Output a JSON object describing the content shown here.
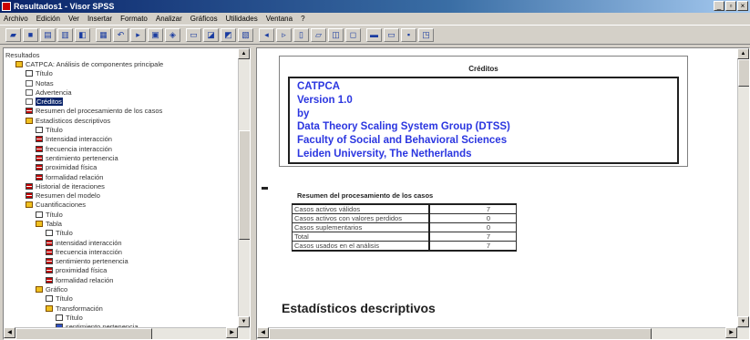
{
  "window": {
    "title": "Resultados1 - Visor SPSS",
    "controls": [
      "minimize",
      "restore",
      "close"
    ]
  },
  "menu": [
    "Archivo",
    "Edición",
    "Ver",
    "Insertar",
    "Formato",
    "Analizar",
    "Gráficos",
    "Utilidades",
    "Ventana",
    "?"
  ],
  "toolbar": {
    "buttons": [
      "open-icon",
      "save-icon",
      "print-icon",
      "print-preview-icon",
      "export-icon",
      "recall-dialog-icon",
      "undo-icon",
      "goto-case-icon",
      "variables-icon",
      "find-icon",
      "insert-cases-icon",
      "weight-cases-icon",
      "select-cases-icon",
      "value-labels-icon",
      "promote-icon",
      "demote-icon",
      "expand-icon",
      "collapse-icon",
      "show-icon",
      "hide-icon",
      "insert-heading-icon",
      "insert-title-icon",
      "insert-text-icon",
      "designate-window-icon"
    ]
  },
  "tree": [
    {
      "label": "Resultados",
      "depth": 0,
      "icon": "none"
    },
    {
      "label": "CATPCA: Análisis de componentes principale",
      "depth": 1,
      "icon": "book"
    },
    {
      "label": "Título",
      "depth": 2,
      "icon": "title"
    },
    {
      "label": "Notas",
      "depth": 2,
      "icon": "doc"
    },
    {
      "label": "Advertencia",
      "depth": 2,
      "icon": "doc"
    },
    {
      "label": "Créditos",
      "depth": 2,
      "icon": "doc",
      "selected": true
    },
    {
      "label": "Resumen del procesamiento de los casos",
      "depth": 2,
      "icon": "table"
    },
    {
      "label": "Estadísticos descriptivos",
      "depth": 2,
      "icon": "book"
    },
    {
      "label": "Título",
      "depth": 3,
      "icon": "title"
    },
    {
      "label": "Intensidad interacción",
      "depth": 3,
      "icon": "table"
    },
    {
      "label": "frecuencia interacción",
      "depth": 3,
      "icon": "table"
    },
    {
      "label": "sentimiento pertenencia",
      "depth": 3,
      "icon": "table"
    },
    {
      "label": "proximidad física",
      "depth": 3,
      "icon": "table"
    },
    {
      "label": "formalidad relación",
      "depth": 3,
      "icon": "table"
    },
    {
      "label": "Historial de iteraciones",
      "depth": 2,
      "icon": "table"
    },
    {
      "label": "Resumen del modelo",
      "depth": 2,
      "icon": "table"
    },
    {
      "label": "Cuantificaciones",
      "depth": 2,
      "icon": "book"
    },
    {
      "label": "Título",
      "depth": 3,
      "icon": "title"
    },
    {
      "label": "Tabla",
      "depth": 3,
      "icon": "book"
    },
    {
      "label": "Título",
      "depth": 4,
      "icon": "title"
    },
    {
      "label": "intensidad interacción",
      "depth": 4,
      "icon": "table"
    },
    {
      "label": "frecuencia interacción",
      "depth": 4,
      "icon": "table"
    },
    {
      "label": "sentimiento pertenencia",
      "depth": 4,
      "icon": "table"
    },
    {
      "label": "proximidad física",
      "depth": 4,
      "icon": "table"
    },
    {
      "label": "formalidad relación",
      "depth": 4,
      "icon": "table"
    },
    {
      "label": "Gráfico",
      "depth": 3,
      "icon": "book"
    },
    {
      "label": "Título",
      "depth": 4,
      "icon": "title"
    },
    {
      "label": "Transformación",
      "depth": 4,
      "icon": "book"
    },
    {
      "label": "Título",
      "depth": 5,
      "icon": "title"
    },
    {
      "label": "sentimiento pertenencia",
      "depth": 5,
      "icon": "chart"
    }
  ],
  "credits": {
    "title": "Créditos",
    "lines": [
      "CATPCA",
      "Version 1.0",
      "by",
      "Data Theory Scaling System Group (DTSS)",
      "Faculty of Social and Behavioral Sciences",
      "Leiden University, The Netherlands"
    ]
  },
  "case_summary": {
    "title": "Resumen del procesamiento de los casos",
    "rows": [
      {
        "label": "Casos activos válidos",
        "value": "7"
      },
      {
        "label": "Casos activos con valores perdidos",
        "value": "0"
      },
      {
        "label": "Casos suplementarios",
        "value": "0"
      },
      {
        "label": "Total",
        "value": "7"
      },
      {
        "label": "Casos usados en el análisis",
        "value": "7"
      }
    ]
  },
  "section_heading": "Estadísticos descriptivos"
}
